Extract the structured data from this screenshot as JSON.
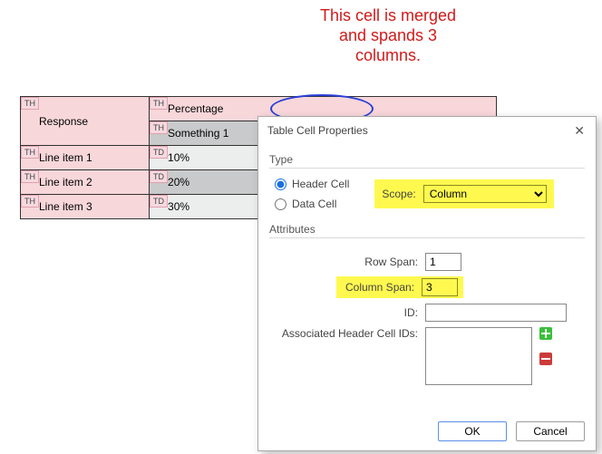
{
  "annotation": {
    "text": "This cell is merged and spands 3 columns."
  },
  "table": {
    "tag_th": "TH",
    "tag_td": "TD",
    "header_response": "Response",
    "header_percentage": "Percentage",
    "subheader": "Something 1",
    "rows": [
      {
        "item": "Line item 1",
        "val": "10%"
      },
      {
        "item": "Line item 2",
        "val": "20%"
      },
      {
        "item": "Line item 3",
        "val": "30%"
      }
    ]
  },
  "dialog": {
    "title": "Table Cell Properties",
    "type_group": "Type",
    "header_cell": "Header Cell",
    "data_cell": "Data Cell",
    "scope_label": "Scope:",
    "scope_value": "Column",
    "attr_group": "Attributes",
    "row_span_label": "Row Span:",
    "row_span_value": "1",
    "col_span_label": "Column Span:",
    "col_span_value": "3",
    "id_label": "ID:",
    "id_value": "",
    "assoc_label": "Associated Header Cell IDs:",
    "assoc_value": "",
    "ok": "OK",
    "cancel": "Cancel"
  }
}
